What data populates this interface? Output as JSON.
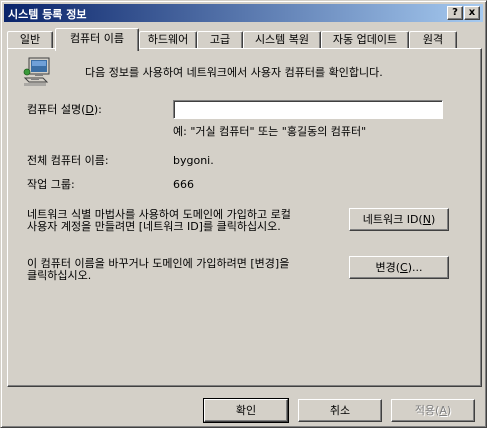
{
  "window": {
    "title": "시스템 등록 정보",
    "help_label": "?",
    "close_label": "x"
  },
  "tabs": [
    {
      "label": "일반"
    },
    {
      "label": "컴퓨터 이름"
    },
    {
      "label": "하드웨어"
    },
    {
      "label": "고급"
    },
    {
      "label": "시스템 복원"
    },
    {
      "label": "자동 업데이트"
    },
    {
      "label": "원격"
    }
  ],
  "panel": {
    "intro": "다음 정보를 사용하여 네트워크에서 사용자 컴퓨터를 확인합니다.",
    "description_label_prefix": "컴퓨터 설명(",
    "description_label_key": "D",
    "description_label_suffix": "):",
    "description_value": "",
    "example_text": "예: \"거실 컴퓨터\" 또는 \"홍길동의 컴퓨터\"",
    "full_name_label": "전체 컴퓨터 이름:",
    "full_name_value": "bygoni.",
    "workgroup_label": "작업 그룹:",
    "workgroup_value": "666",
    "network_id_text_line1": "네트워크 식별 마법사를 사용하여 도메인에 가입하고 로컬",
    "network_id_text_line2": "사용자 계정을 만들려면 [네트워크 ID]를 클릭하십시오.",
    "network_id_button_prefix": "네트워크 ID(",
    "network_id_button_key": "N",
    "network_id_button_suffix": ")",
    "change_text_line1": "이 컴퓨터 이름을 바꾸거나 도메인에 가입하려면 [변경]을",
    "change_text_line2": "클릭하십시오.",
    "change_button_prefix": "변경(",
    "change_button_key": "C",
    "change_button_suffix": ")..."
  },
  "footer": {
    "ok_label": "확인",
    "cancel_label": "취소",
    "apply_prefix": "적용(",
    "apply_key": "A",
    "apply_suffix": ")"
  }
}
